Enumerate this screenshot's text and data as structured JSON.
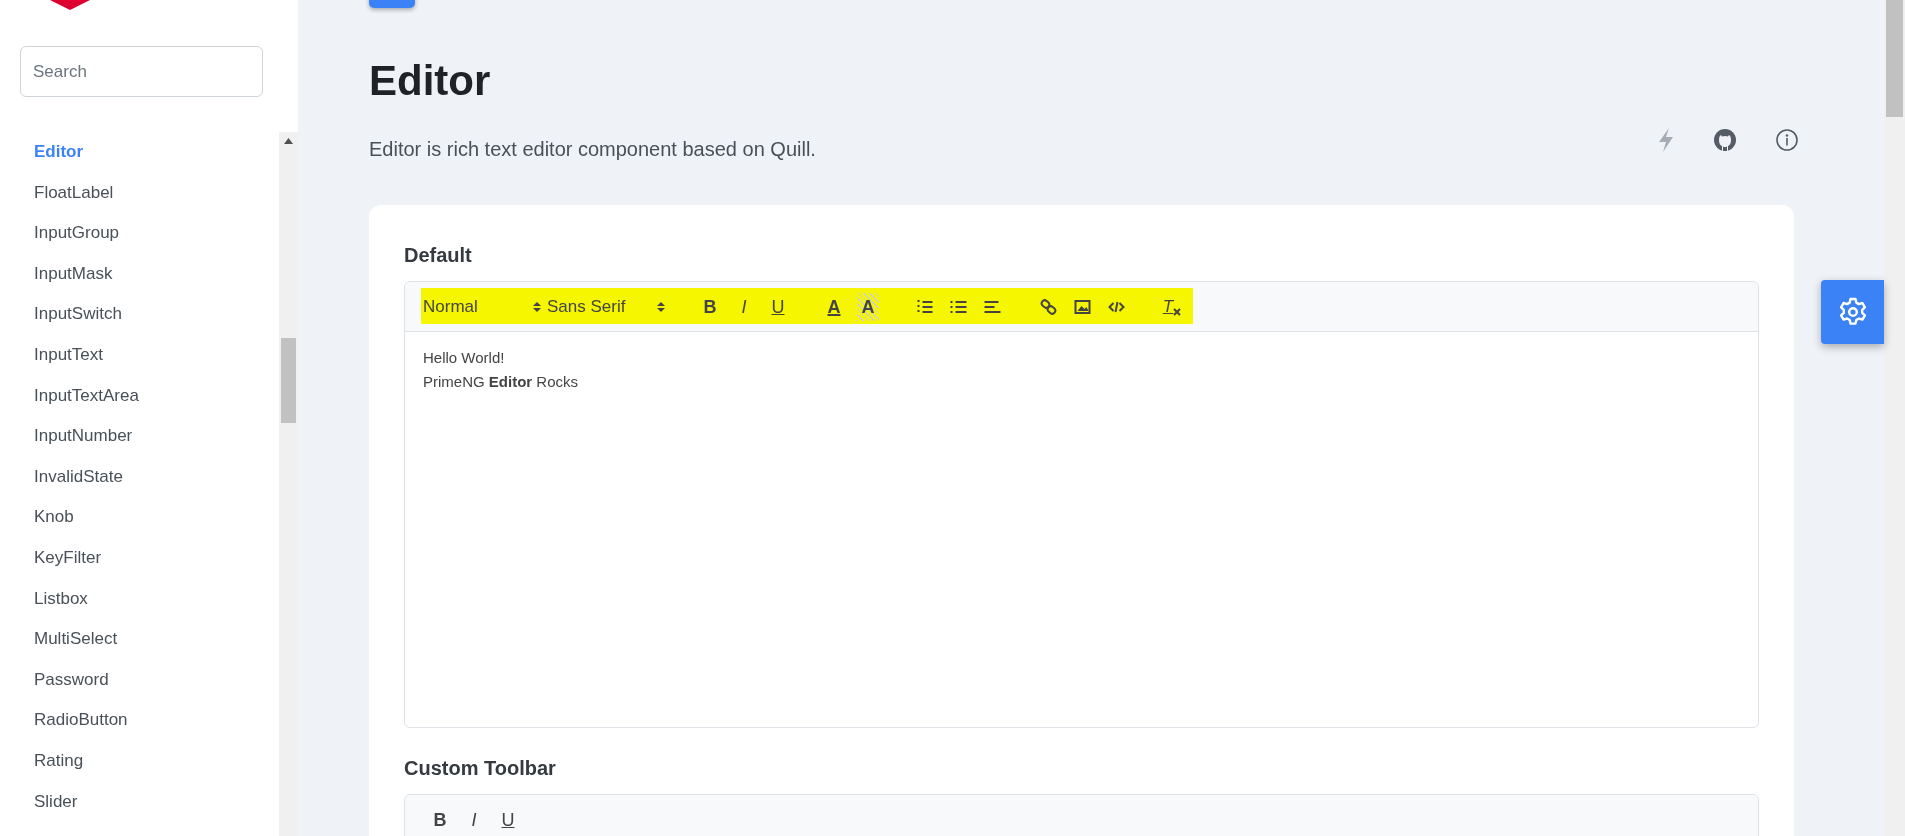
{
  "sidebar": {
    "search": {
      "placeholder": "Search"
    },
    "items": [
      {
        "label": "Editor",
        "selected": true
      },
      {
        "label": "FloatLabel",
        "selected": false
      },
      {
        "label": "InputGroup",
        "selected": false
      },
      {
        "label": "InputMask",
        "selected": false
      },
      {
        "label": "InputSwitch",
        "selected": false
      },
      {
        "label": "InputText",
        "selected": false
      },
      {
        "label": "InputTextArea",
        "selected": false
      },
      {
        "label": "InputNumber",
        "selected": false
      },
      {
        "label": "InvalidState",
        "selected": false
      },
      {
        "label": "Knob",
        "selected": false
      },
      {
        "label": "KeyFilter",
        "selected": false
      },
      {
        "label": "Listbox",
        "selected": false
      },
      {
        "label": "MultiSelect",
        "selected": false
      },
      {
        "label": "Password",
        "selected": false
      },
      {
        "label": "RadioButton",
        "selected": false
      },
      {
        "label": "Rating",
        "selected": false
      },
      {
        "label": "Slider",
        "selected": false
      }
    ]
  },
  "page": {
    "title": "Editor",
    "description": "Editor is rich text editor component based on Quill."
  },
  "sections": [
    {
      "title": "Default",
      "highlighted": true,
      "toolbar": [
        {
          "kind": "picker",
          "label": "Normal"
        },
        {
          "kind": "picker",
          "label": "Sans Serif"
        },
        {
          "kind": "bold",
          "label": "B"
        },
        {
          "kind": "italic",
          "label": "I"
        },
        {
          "kind": "underline",
          "label": "U"
        },
        {
          "kind": "color",
          "label": "A"
        },
        {
          "kind": "background",
          "label": "A"
        },
        {
          "kind": "ordered-list"
        },
        {
          "kind": "bullet-list"
        },
        {
          "kind": "align"
        },
        {
          "kind": "link"
        },
        {
          "kind": "image"
        },
        {
          "kind": "code"
        },
        {
          "kind": "clean",
          "label": "T"
        }
      ],
      "content": [
        "Hello World!",
        "PrimeNG **Editor** Rocks"
      ]
    },
    {
      "title": "Custom Toolbar",
      "highlighted": false,
      "toolbar": [
        {
          "kind": "bold",
          "label": "B"
        },
        {
          "kind": "italic",
          "label": "I"
        },
        {
          "kind": "underline",
          "label": "U"
        }
      ]
    }
  ]
}
